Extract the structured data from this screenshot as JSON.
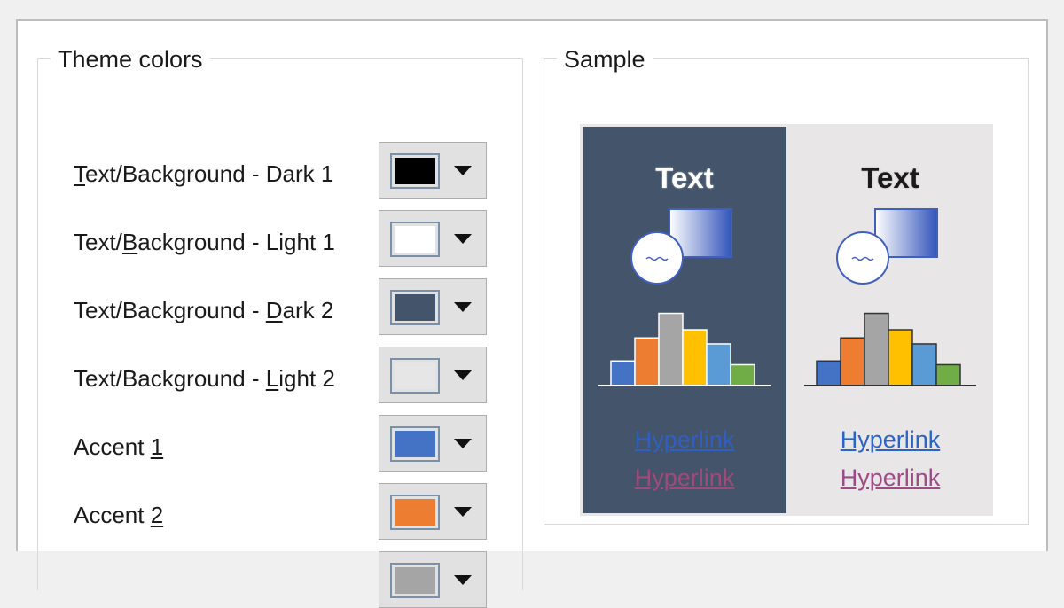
{
  "theme": {
    "title": "Theme colors",
    "rows": [
      {
        "prefix": "",
        "key": "T",
        "suffix": "ext/Background - Dark 1",
        "color": "#000000"
      },
      {
        "prefix": "Text/",
        "key": "B",
        "suffix": "ackground - Light 1",
        "color": "#ffffff"
      },
      {
        "prefix": "Text/Background - ",
        "key": "D",
        "suffix": "ark 2",
        "color": "#44546a"
      },
      {
        "prefix": "Text/Background - ",
        "key": "L",
        "suffix": "ight 2",
        "color": "#e7e6e6"
      },
      {
        "prefix": "Accent ",
        "key": "1",
        "suffix": "",
        "color": "#4472c4"
      },
      {
        "prefix": "Accent ",
        "key": "2",
        "suffix": "",
        "color": "#ed7d31"
      },
      {
        "prefix": "",
        "key": "",
        "suffix": "",
        "color": "#a5a5a5"
      }
    ]
  },
  "sample": {
    "title": "Sample",
    "text_label": "Text",
    "hyperlink": "Hyperlink",
    "followed_hyperlink": "Hyperlink",
    "accent_colors": [
      "#4472c4",
      "#ed7d31",
      "#a5a5a5",
      "#ffc000",
      "#5b9bd5",
      "#70ad47"
    ],
    "bar_levels": [
      0.33,
      0.64,
      0.97,
      0.75,
      0.56,
      0.28
    ]
  }
}
